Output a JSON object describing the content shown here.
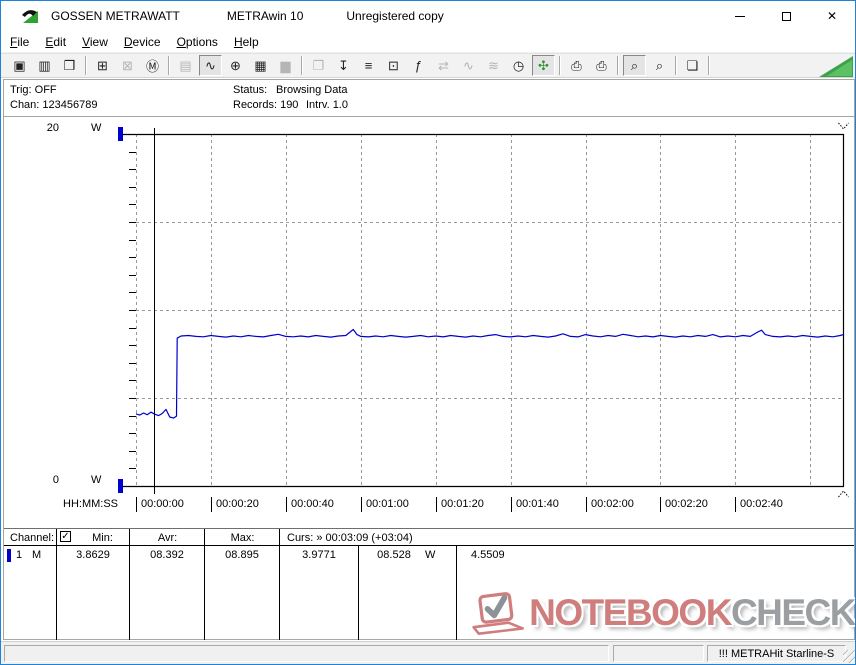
{
  "window": {
    "title_app": "GOSSEN METRAWATT",
    "title_product": "METRAwin 10",
    "title_license": "Unregistered copy",
    "close_glyph": "✕"
  },
  "menu": {
    "items": [
      {
        "label": "File"
      },
      {
        "label": "Edit"
      },
      {
        "label": "View"
      },
      {
        "label": "Device"
      },
      {
        "label": "Options"
      },
      {
        "label": "Help"
      }
    ]
  },
  "toolbar": {
    "items": [
      {
        "name": "save-data-icon",
        "glyph": "▣"
      },
      {
        "name": "save-as-icon",
        "glyph": "▥"
      },
      {
        "name": "open-file-icon",
        "glyph": "❒"
      },
      {
        "sep": true
      },
      {
        "name": "device-download-icon",
        "glyph": "⊞"
      },
      {
        "name": "device-stop-icon",
        "glyph": "⊠",
        "state": "disabled"
      },
      {
        "name": "device-memory-icon",
        "glyph": "Ⓜ"
      },
      {
        "sep": true
      },
      {
        "name": "numeric-display-icon",
        "glyph": "▤",
        "state": "disabled"
      },
      {
        "name": "waveform-display-icon",
        "glyph": "∿",
        "state": "pressed"
      },
      {
        "name": "crosshair-display-icon",
        "glyph": "⊕"
      },
      {
        "name": "table-display-icon",
        "glyph": "▦"
      },
      {
        "name": "bargraph-display-icon",
        "glyph": "▆",
        "state": "disabled"
      },
      {
        "sep": true
      },
      {
        "name": "copy-window-icon",
        "glyph": "❐",
        "state": "disabled"
      },
      {
        "name": "export-data-icon",
        "glyph": "↧"
      },
      {
        "name": "channel-setup-icon",
        "glyph": "≡"
      },
      {
        "name": "monitor-setup-icon",
        "glyph": "⊡"
      },
      {
        "name": "formula-icon",
        "glyph": "ƒ"
      },
      {
        "name": "transfer-icon",
        "glyph": "⇄",
        "state": "disabled"
      },
      {
        "name": "wave-single-icon",
        "glyph": "∿",
        "state": "disabled"
      },
      {
        "name": "wave-multi-icon",
        "glyph": "≋",
        "state": "disabled"
      },
      {
        "name": "timer-icon",
        "glyph": "◷"
      },
      {
        "name": "live-view-icon",
        "glyph": "✣",
        "state": "pressed",
        "color": "#2c9632"
      },
      {
        "sep": true
      },
      {
        "name": "print-data-icon",
        "glyph": "⎙"
      },
      {
        "name": "print-chart-icon",
        "glyph": "⎙"
      },
      {
        "sep": true
      },
      {
        "name": "zoom-wave-icon",
        "glyph": "⌕",
        "state": "pressed"
      },
      {
        "name": "zoom-select-icon",
        "glyph": "⌕"
      },
      {
        "sep": true
      },
      {
        "name": "annotation-icon",
        "glyph": "❏"
      },
      {
        "sep": true
      }
    ]
  },
  "info": {
    "trig": "Trig: OFF",
    "chan": "Chan: 123456789",
    "status_label": "Status:",
    "status_value": "Browsing Data",
    "records": "Records: 190",
    "interval": "Intrv. 1.0"
  },
  "chart_data": {
    "type": "line",
    "title": "Power draw vs time (METRAwin browsing view)",
    "xlabel": "HH:MM:SS",
    "ylabel": "W",
    "ylim": [
      0,
      20
    ],
    "x_range_seconds": [
      0,
      189
    ],
    "grid": "dashed",
    "legend_position": "none",
    "y_axis_labels": [
      {
        "value": 20,
        "label": "20",
        "unit": "W"
      },
      {
        "value": 0,
        "label": "0",
        "unit": "W"
      }
    ],
    "y_gridline_values": [
      5,
      10,
      15
    ],
    "x_ticks": [
      {
        "seconds": 0,
        "label": "00:00:00"
      },
      {
        "seconds": 20,
        "label": "00:00:20"
      },
      {
        "seconds": 40,
        "label": "00:00:40"
      },
      {
        "seconds": 60,
        "label": "00:01:00"
      },
      {
        "seconds": 80,
        "label": "00:01:20"
      },
      {
        "seconds": 100,
        "label": "00:01:40"
      },
      {
        "seconds": 120,
        "label": "00:02:00"
      },
      {
        "seconds": 140,
        "label": "00:02:20"
      },
      {
        "seconds": 160,
        "label": "00:02:40"
      }
    ],
    "x_gridline_seconds": [
      20,
      40,
      60,
      80,
      100,
      120,
      140,
      160,
      180
    ],
    "cursors": {
      "a_seconds": 4.8,
      "b_seconds": 188.8,
      "readout": "Curs: » 00:03:09 (+03:04)"
    },
    "stats": {
      "min": 3.8629,
      "avr": 8.392,
      "max": 8.895,
      "value_at_cursor_a": 3.9771,
      "value_at_cursor_b": 8.528,
      "delta": 4.5509,
      "unit": "W"
    },
    "series": [
      {
        "name": "Channel 1",
        "unit": "W",
        "color": "#0000cc",
        "points": [
          [
            0,
            4.1
          ],
          [
            1,
            4.03
          ],
          [
            2,
            4.15
          ],
          [
            3,
            4.05
          ],
          [
            4,
            4.2
          ],
          [
            5,
            4.08
          ],
          [
            6,
            4.0
          ],
          [
            7,
            4.12
          ],
          [
            8,
            4.35
          ],
          [
            9,
            3.92
          ],
          [
            10,
            3.86
          ],
          [
            10.8,
            3.97
          ],
          [
            11,
            8.4
          ],
          [
            12,
            8.52
          ],
          [
            14,
            8.55
          ],
          [
            16,
            8.5
          ],
          [
            18,
            8.48
          ],
          [
            20,
            8.55
          ],
          [
            22,
            8.5
          ],
          [
            24,
            8.46
          ],
          [
            26,
            8.52
          ],
          [
            28,
            8.48
          ],
          [
            30,
            8.55
          ],
          [
            32,
            8.5
          ],
          [
            34,
            8.47
          ],
          [
            36,
            8.55
          ],
          [
            38,
            8.62
          ],
          [
            40,
            8.5
          ],
          [
            42,
            8.48
          ],
          [
            44,
            8.52
          ],
          [
            46,
            8.47
          ],
          [
            48,
            8.55
          ],
          [
            50,
            8.5
          ],
          [
            52,
            8.46
          ],
          [
            54,
            8.52
          ],
          [
            56,
            8.55
          ],
          [
            57,
            8.72
          ],
          [
            58,
            8.89
          ],
          [
            59,
            8.6
          ],
          [
            60,
            8.5
          ],
          [
            62,
            8.47
          ],
          [
            64,
            8.52
          ],
          [
            66,
            8.48
          ],
          [
            68,
            8.55
          ],
          [
            70,
            8.5
          ],
          [
            72,
            8.46
          ],
          [
            74,
            8.5
          ],
          [
            76,
            8.55
          ],
          [
            78,
            8.48
          ],
          [
            80,
            8.52
          ],
          [
            82,
            8.47
          ],
          [
            84,
            8.55
          ],
          [
            86,
            8.5
          ],
          [
            88,
            8.46
          ],
          [
            90,
            8.52
          ],
          [
            92,
            8.48
          ],
          [
            94,
            8.55
          ],
          [
            96,
            8.6
          ],
          [
            98,
            8.5
          ],
          [
            100,
            8.47
          ],
          [
            102,
            8.52
          ],
          [
            104,
            8.48
          ],
          [
            106,
            8.55
          ],
          [
            108,
            8.5
          ],
          [
            110,
            8.46
          ],
          [
            112,
            8.52
          ],
          [
            114,
            8.65
          ],
          [
            116,
            8.5
          ],
          [
            118,
            8.47
          ],
          [
            120,
            8.6
          ],
          [
            122,
            8.52
          ],
          [
            124,
            8.48
          ],
          [
            126,
            8.55
          ],
          [
            128,
            8.5
          ],
          [
            130,
            8.62
          ],
          [
            132,
            8.55
          ],
          [
            134,
            8.48
          ],
          [
            136,
            8.52
          ],
          [
            138,
            8.47
          ],
          [
            140,
            8.55
          ],
          [
            142,
            8.5
          ],
          [
            144,
            8.46
          ],
          [
            146,
            8.52
          ],
          [
            148,
            8.48
          ],
          [
            150,
            8.55
          ],
          [
            152,
            8.5
          ],
          [
            154,
            8.6
          ],
          [
            156,
            8.47
          ],
          [
            158,
            8.52
          ],
          [
            160,
            8.48
          ],
          [
            162,
            8.55
          ],
          [
            164,
            8.5
          ],
          [
            166,
            8.75
          ],
          [
            167,
            8.85
          ],
          [
            168,
            8.6
          ],
          [
            170,
            8.5
          ],
          [
            172,
            8.47
          ],
          [
            174,
            8.52
          ],
          [
            176,
            8.48
          ],
          [
            178,
            8.55
          ],
          [
            180,
            8.5
          ],
          [
            182,
            8.46
          ],
          [
            184,
            8.52
          ],
          [
            186,
            8.48
          ],
          [
            188,
            8.55
          ],
          [
            189,
            8.62
          ]
        ]
      }
    ]
  },
  "table": {
    "headers": {
      "channel": "Channel:",
      "min": "Min:",
      "avr": "Avr:",
      "max": "Max:",
      "cursor": "Curs: » 00:03:09 (+03:04)"
    },
    "checkbox_checked": "✓",
    "row": {
      "channel_num": "1",
      "channel_mode": "M",
      "min": "3.8629",
      "avr": "08.392",
      "max": "08.895",
      "cursor_a": "3.9771",
      "cursor_b": "08.528",
      "cursor_b_unit": "W",
      "cursor_delta": "4.5509"
    }
  },
  "statusbar": {
    "device": "!!! METRAHit Starline-S"
  },
  "watermark": {
    "text_primary": "NOTEBOOK",
    "text_secondary": "CHECK",
    "color_primary": "#cf7d7d",
    "color_secondary": "#9b9fa2"
  },
  "colors": {
    "accent_blue": "#0000cc",
    "window_border": "#1d83d8",
    "grid_gray": "#999999",
    "toolbar_triangle_green": "#3fa24a"
  }
}
